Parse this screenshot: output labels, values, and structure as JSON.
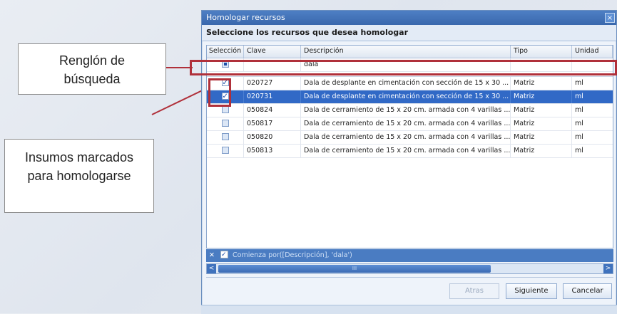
{
  "dialog": {
    "title": "Homologar recursos",
    "close_glyph": "×",
    "subtitle": "Seleccione los recursos que desea homologar"
  },
  "grid": {
    "columns": [
      "Selección",
      "Clave",
      "Descripción",
      "Tipo",
      "Unidad"
    ],
    "filter_row": {
      "descripcion": "dala"
    },
    "rows": [
      {
        "selected": true,
        "checked": true,
        "clave": "020727",
        "descripcion": "Dala de desplante en cimentación con sección de 15 x 30 ...",
        "tipo": "Matriz",
        "unidad": "ml"
      },
      {
        "selected": true,
        "checked": true,
        "clave": "020731",
        "descripcion": "Dala de desplante en cimentación con sección de 15 x 30 ...",
        "tipo": "Matriz",
        "unidad": "ml",
        "highlighted": true
      },
      {
        "selected": false,
        "checked": false,
        "clave": "050824",
        "descripcion": "Dala de cerramiento de 15 x 20 cm. armada con 4 varillas ...",
        "tipo": "Matriz",
        "unidad": "ml"
      },
      {
        "selected": false,
        "checked": false,
        "clave": "050817",
        "descripcion": "Dala de cerramiento de 15 x 20 cm. armada con 4 varillas ...",
        "tipo": "Matriz",
        "unidad": "ml"
      },
      {
        "selected": false,
        "checked": false,
        "clave": "050820",
        "descripcion": "Dala de cerramiento de 15 x 20 cm. armada con 4 varillas ...",
        "tipo": "Matriz",
        "unidad": "ml"
      },
      {
        "selected": false,
        "checked": false,
        "clave": "050813",
        "descripcion": "Dala de cerramiento de 15 x 20 cm. armada con 4 varillas ...",
        "tipo": "Matriz",
        "unidad": "ml"
      }
    ]
  },
  "filterbar": {
    "clear_glyph": "✕",
    "text": "Comienza por([Descripción], 'dala')"
  },
  "scrollbar": {
    "left_glyph": "<",
    "right_glyph": ">",
    "thumb_grip": "III"
  },
  "buttons": {
    "back": "Atras",
    "next": "Siguiente",
    "cancel": "Cancelar"
  },
  "annotations": {
    "search_row": "Renglón de búsqueda",
    "marked_items": "Insumos marcados para homologarse"
  },
  "colors": {
    "highlight": "#b0303a",
    "selection": "#3169c6",
    "titlebar": "#3a68ad"
  }
}
